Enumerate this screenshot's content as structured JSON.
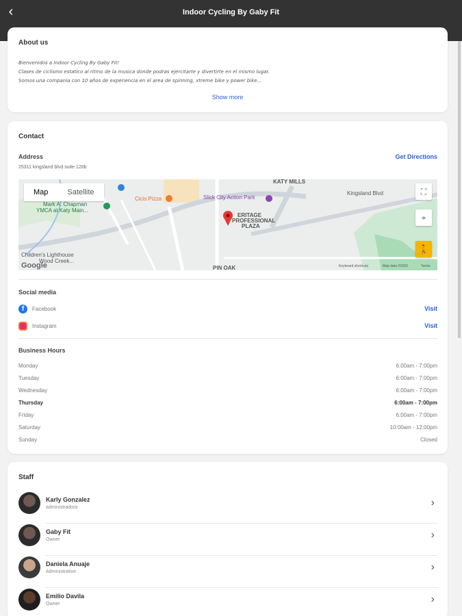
{
  "header": {
    "title": "Indoor Cycling By Gaby Fit",
    "back_icon": "chevron-left-icon"
  },
  "about": {
    "heading": "About us",
    "lines": [
      "Bienvenidos a Indoor Cycling By Gaby Fit!",
      "Clases de ciclismo estatico al ritmo de la musica donde podras ejercitarte y divertirte en el mismo lugar.",
      "Somos una compania con 10 años de experiencia en el area de spinning, xtreme bike y power bike..."
    ],
    "show_more": "Show more"
  },
  "contact": {
    "heading": "Contact",
    "address_label": "Address",
    "address": "25311 kingsland blvd suite 120b",
    "directions": "Get Directions",
    "map": {
      "map_tab": "Map",
      "satellite_tab": "Satellite",
      "labels": {
        "katy_mills": "KATY MILLS",
        "kingsland": "Kingsland Blvd",
        "cicis": "Cicis Pizza",
        "slick": "Slick City Action Park",
        "ymca1": "Mark A. Chapman",
        "ymca2": "YMCA at Katy Main...",
        "heritage1": "ERITAGE",
        "heritage2": "PROFESSIONAL",
        "heritage3": "PLAZA",
        "childrens1": "Children's Lighthouse",
        "childrens2": "Wood Creek...",
        "pin_oak": "PIN OAK",
        "google": "Google",
        "kbd": "Keyboard shortcuts",
        "mapdata": "Map data ©2023",
        "terms": "Terms"
      }
    },
    "social_heading": "Social media",
    "social": [
      {
        "name": "Facebook",
        "icon": "facebook-icon",
        "action": "Visit",
        "color": "#1877f2"
      },
      {
        "name": "Instagram",
        "icon": "instagram-icon",
        "action": "Visit",
        "color": "#e1306c"
      }
    ],
    "hours_heading": "Business Hours",
    "hours": [
      {
        "day": "Monday",
        "time": "6:00am - 7:00pm"
      },
      {
        "day": "Tuesday",
        "time": "6:00am - 7:00pm"
      },
      {
        "day": "Wednesday",
        "time": "6:00am - 7:00pm"
      },
      {
        "day": "Thursday",
        "time": "6:00am - 7:00pm"
      },
      {
        "day": "Friday",
        "time": "6:00am - 7:00pm"
      },
      {
        "day": "Saturday",
        "time": "10:00am - 12:00pm"
      },
      {
        "day": "Sunday",
        "time": "Closed"
      }
    ]
  },
  "staff": {
    "heading": "Staff",
    "members": [
      {
        "name": "Karly Gonzalez",
        "role": "administradora"
      },
      {
        "name": "Gaby Fit",
        "role": "Owner"
      },
      {
        "name": "Daniela Anuaje",
        "role": "Administrative"
      },
      {
        "name": "Emilio Davila",
        "role": "Owner"
      }
    ]
  },
  "colors": {
    "header_bg": "#333333",
    "link": "#2a5fd6",
    "map_pin": "#e53935"
  }
}
